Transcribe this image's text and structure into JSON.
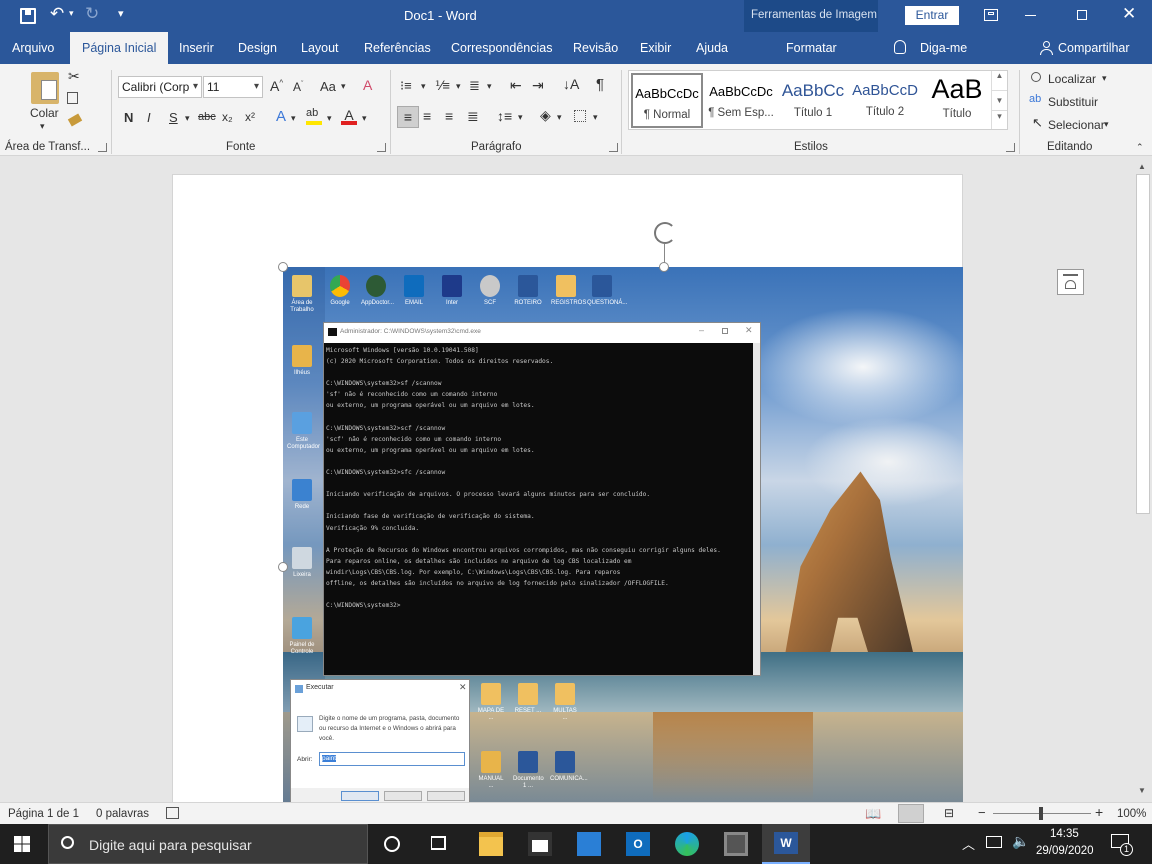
{
  "titlebar": {
    "document_title": "Doc1 - Word",
    "contextual_tab_group": "Ferramentas de Imagem",
    "signin_label": "Entrar"
  },
  "tabs": [
    "Arquivo",
    "Página Inicial",
    "Inserir",
    "Design",
    "Layout",
    "Referências",
    "Correspondências",
    "Revisão",
    "Exibir",
    "Ajuda",
    "Formatar"
  ],
  "tell_me": "Diga-me",
  "share": "Compartilhar",
  "ribbon": {
    "clipboard": {
      "paste_label": "Colar",
      "group_label": "Área de Transf..."
    },
    "font": {
      "font_name": "Calibri (Corp",
      "font_size": "11",
      "change_case": "Aa",
      "bold": "N",
      "italic": "I",
      "underline": "S",
      "strike": "abc",
      "subscript": "x₂",
      "superscript": "x²",
      "group_label": "Fonte"
    },
    "paragraph": {
      "group_label": "Parágrafo",
      "pilcrow": "¶"
    },
    "styles": {
      "group_label": "Estilos",
      "items": [
        {
          "preview": "AaBbCcDc",
          "name": "¶ Normal"
        },
        {
          "preview": "AaBbCcDc",
          "name": "¶ Sem Esp..."
        },
        {
          "preview": "AaBbCc",
          "name": "Título 1"
        },
        {
          "preview": "AaBbCcD",
          "name": "Título 2"
        },
        {
          "preview": "AaB",
          "name": "Título"
        }
      ]
    },
    "editing": {
      "find": "Localizar",
      "replace": "Substituir",
      "select": "Selecionar",
      "group_label": "Editando"
    }
  },
  "embedded_screenshot": {
    "desktop_icons": [
      "Área de Trabalho",
      "Google",
      "AppDoctor...",
      "EMAIL",
      "Inter",
      "SCF",
      "ROTEIRO",
      "REGISTROS",
      "QUESTIONÁ...",
      "Ilhéus",
      "Este Computador",
      "Rede",
      "Lixeira",
      "Painel de Controle"
    ],
    "cmd_window": {
      "title": "Administrador: C:\\WINDOWS\\system32\\cmd.exe",
      "lines": [
        "Microsoft Windows [versão 10.0.19041.508]",
        "(c) 2020 Microsoft Corporation. Todos os direitos reservados.",
        "",
        "C:\\WINDOWS\\system32>sf /scannow",
        "'sf' não é reconhecido como um comando interno",
        "ou externo, um programa operável ou um arquivo em lotes.",
        "",
        "C:\\WINDOWS\\system32>scf /scannow",
        "'scf' não é reconhecido como um comando interno",
        "ou externo, um programa operável ou um arquivo em lotes.",
        "",
        "C:\\WINDOWS\\system32>sfc /scannow",
        "",
        "Iniciando verificação de arquivos. O processo levará alguns minutos para ser concluído.",
        "",
        "Iniciando fase de verificação de verificação do sistema.",
        "Verificação 9% concluída.",
        "",
        "A Proteção de Recursos do Windows encontrou arquivos corrompidos, mas não conseguiu corrigir alguns deles.",
        "Para reparos online, os detalhes são incluídos no arquivo de log CBS localizado em",
        "windir\\Logs\\CBS\\CBS.log. Por exemplo, C:\\Windows\\Logs\\CBS\\CBS.log. Para reparos",
        "offline, os detalhes são incluídos no arquivo de log fornecido pelo sinalizador /OFFLOGFILE.",
        "",
        "C:\\WINDOWS\\system32>"
      ]
    },
    "run_dialog": {
      "title": "Executar",
      "description": "Digite o nome de um programa, pasta, documento ou recurso da Internet e o Windows o abrirá para você.",
      "open_label": "Abrir:",
      "value": "paint"
    },
    "bottom_icons": [
      "MAPA DE ...",
      "RESET ...",
      "MULTAS ...",
      "MANUAL ...",
      "Documento 1 ...",
      "COMUNICA..."
    ]
  },
  "status": {
    "page": "Página 1 de 1",
    "words": "0 palavras",
    "zoom": "100%"
  },
  "taskbar": {
    "search_placeholder": "Digite aqui para pesquisar",
    "time": "14:35",
    "date": "29/09/2020",
    "notifications": "1"
  },
  "colors": {
    "word_blue": "#2b579a",
    "taskbar": "#1f1f1f",
    "ribbon_bg": "#f3f3f3"
  }
}
